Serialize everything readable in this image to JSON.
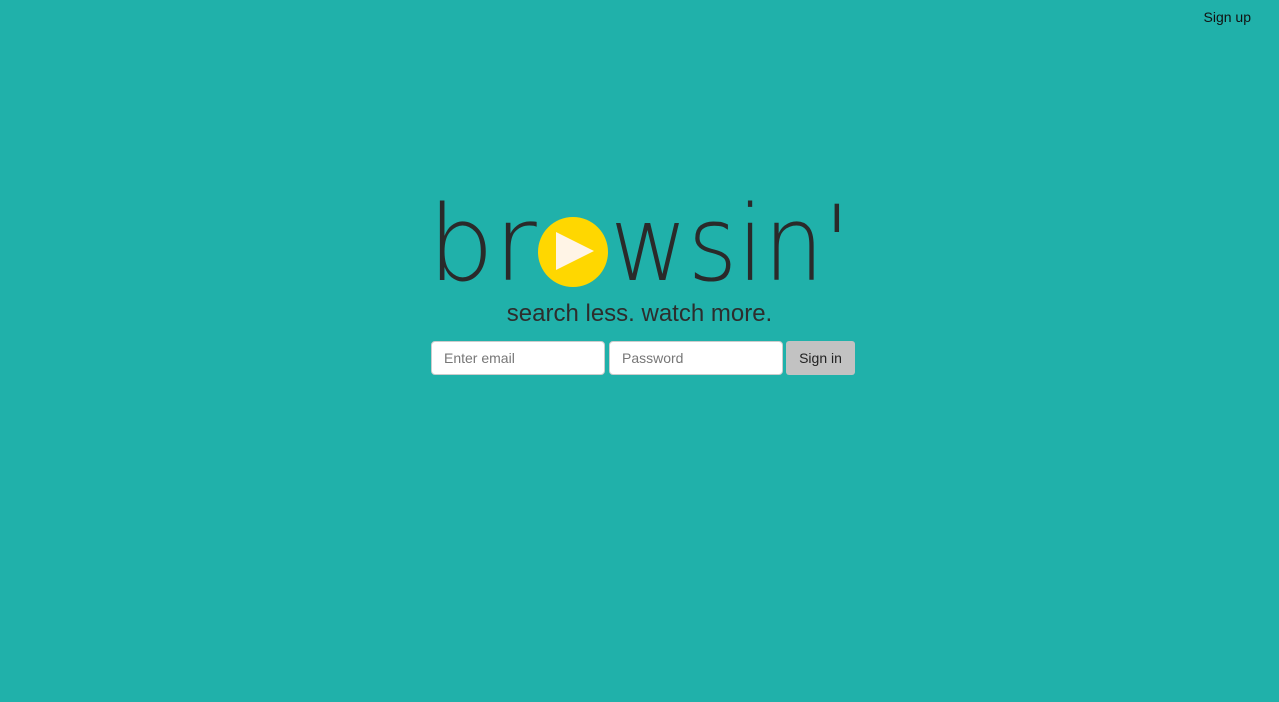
{
  "nav": {
    "signup_label": "Sign up"
  },
  "logo": {
    "text_before": "br",
    "text_after": "wsin'",
    "icon": "play-circle-icon",
    "colors": {
      "text": "#2a2a2a",
      "circle": "#ffd700",
      "play": "#fff4e6"
    }
  },
  "tagline": "search less. watch more.",
  "signin": {
    "email_placeholder": "Enter email",
    "password_placeholder": "Password",
    "button_label": "Sign in"
  },
  "colors": {
    "background": "#20b1aa",
    "button": "#c2c2c2"
  }
}
